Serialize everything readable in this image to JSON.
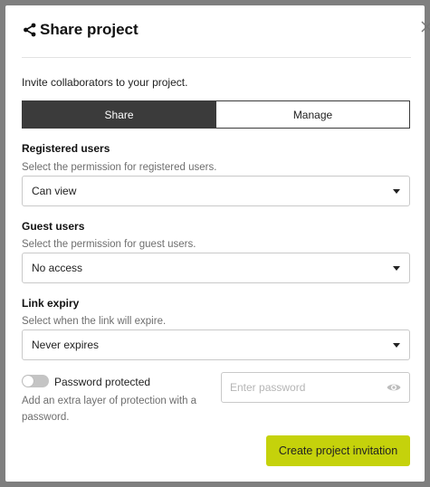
{
  "dialog": {
    "title": "Share project",
    "intro": "Invite collaborators to your project.",
    "tabs": [
      {
        "label": "Share",
        "active": true
      },
      {
        "label": "Manage",
        "active": false
      }
    ],
    "registered": {
      "label": "Registered users",
      "help": "Select the permission for registered users.",
      "value": "Can view"
    },
    "guest": {
      "label": "Guest users",
      "help": "Select the permission for guest users.",
      "value": "No access"
    },
    "expiry": {
      "label": "Link expiry",
      "help": "Select when the link will expire.",
      "value": "Never expires"
    },
    "password": {
      "toggle_label": "Password protected",
      "toggle_on": false,
      "help": "Add an extra layer of protection with a password.",
      "placeholder": "Enter password",
      "value": ""
    },
    "create_label": "Create project invitation"
  },
  "colors": {
    "overlay": "#7f7f7f",
    "tab_active": "#3b3b3b",
    "accent_button": "#c5d20b",
    "help_text": "#6e6e6e"
  },
  "icons": {
    "title": "share-icon",
    "close": "close-icon",
    "select": "caret-down-icon",
    "password": "eye-icon"
  }
}
